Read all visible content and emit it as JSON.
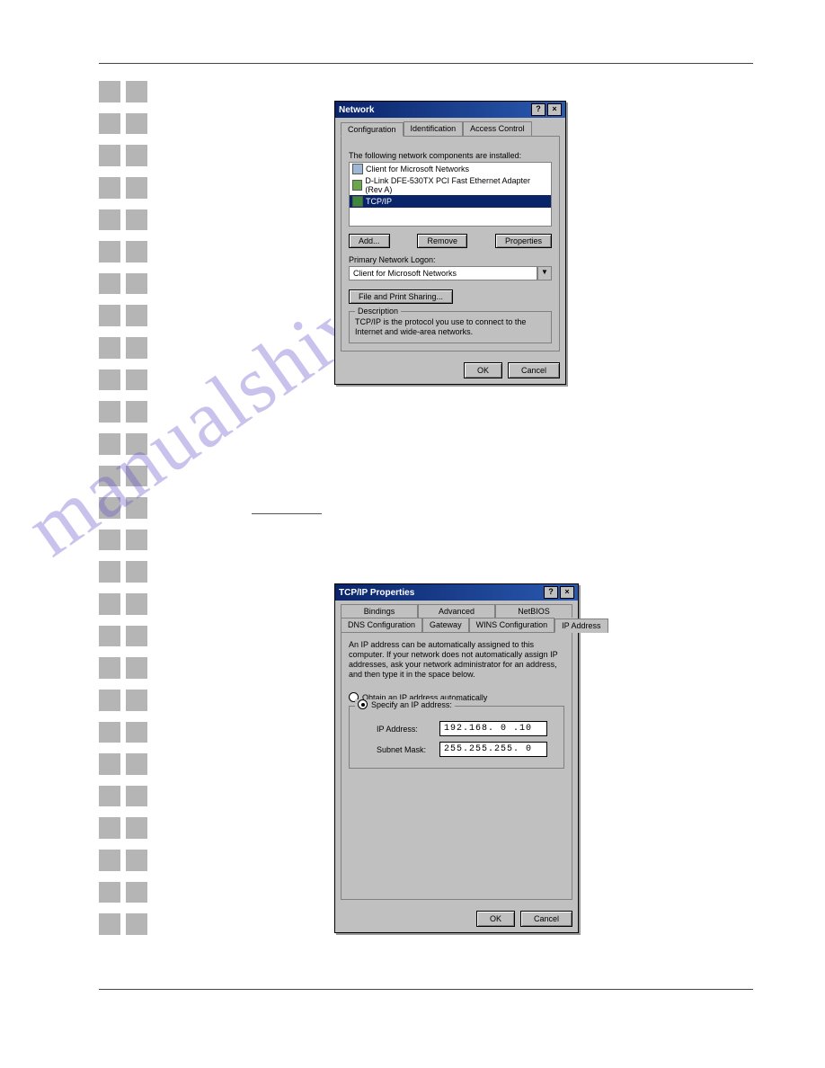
{
  "watermark": "manualshive.com",
  "dialog1": {
    "title": "Network",
    "tabs": [
      "Configuration",
      "Identification",
      "Access Control"
    ],
    "components_label": "The following network components are installed:",
    "components": [
      "Client for Microsoft Networks",
      "D-Link DFE-530TX PCI Fast Ethernet Adapter (Rev A)",
      "TCP/IP"
    ],
    "add_btn": "Add...",
    "remove_btn": "Remove",
    "properties_btn": "Properties",
    "primary_logon_label": "Primary Network Logon:",
    "primary_logon_value": "Client for Microsoft Networks",
    "file_print_btn": "File and Print Sharing...",
    "description_legend": "Description",
    "description_text": "TCP/IP is the protocol you use to connect to the Internet and wide-area networks.",
    "ok": "OK",
    "cancel": "Cancel"
  },
  "dialog2": {
    "title": "TCP/IP Properties",
    "tabs_row1": [
      "Bindings",
      "Advanced",
      "NetBIOS"
    ],
    "tabs_row2": [
      "DNS Configuration",
      "Gateway",
      "WINS Configuration",
      "IP Address"
    ],
    "info_text": "An IP address can be automatically assigned to this computer. If your network does not automatically assign IP addresses, ask your network administrator for an address, and then type it in the space below.",
    "radio_auto": "Obtain an IP address automatically",
    "radio_specify": "Specify an IP address:",
    "ip_label": "IP Address:",
    "ip_value": "192.168. 0 .10",
    "subnet_label": "Subnet Mask:",
    "subnet_value": "255.255.255. 0",
    "ok": "OK",
    "cancel": "Cancel"
  }
}
